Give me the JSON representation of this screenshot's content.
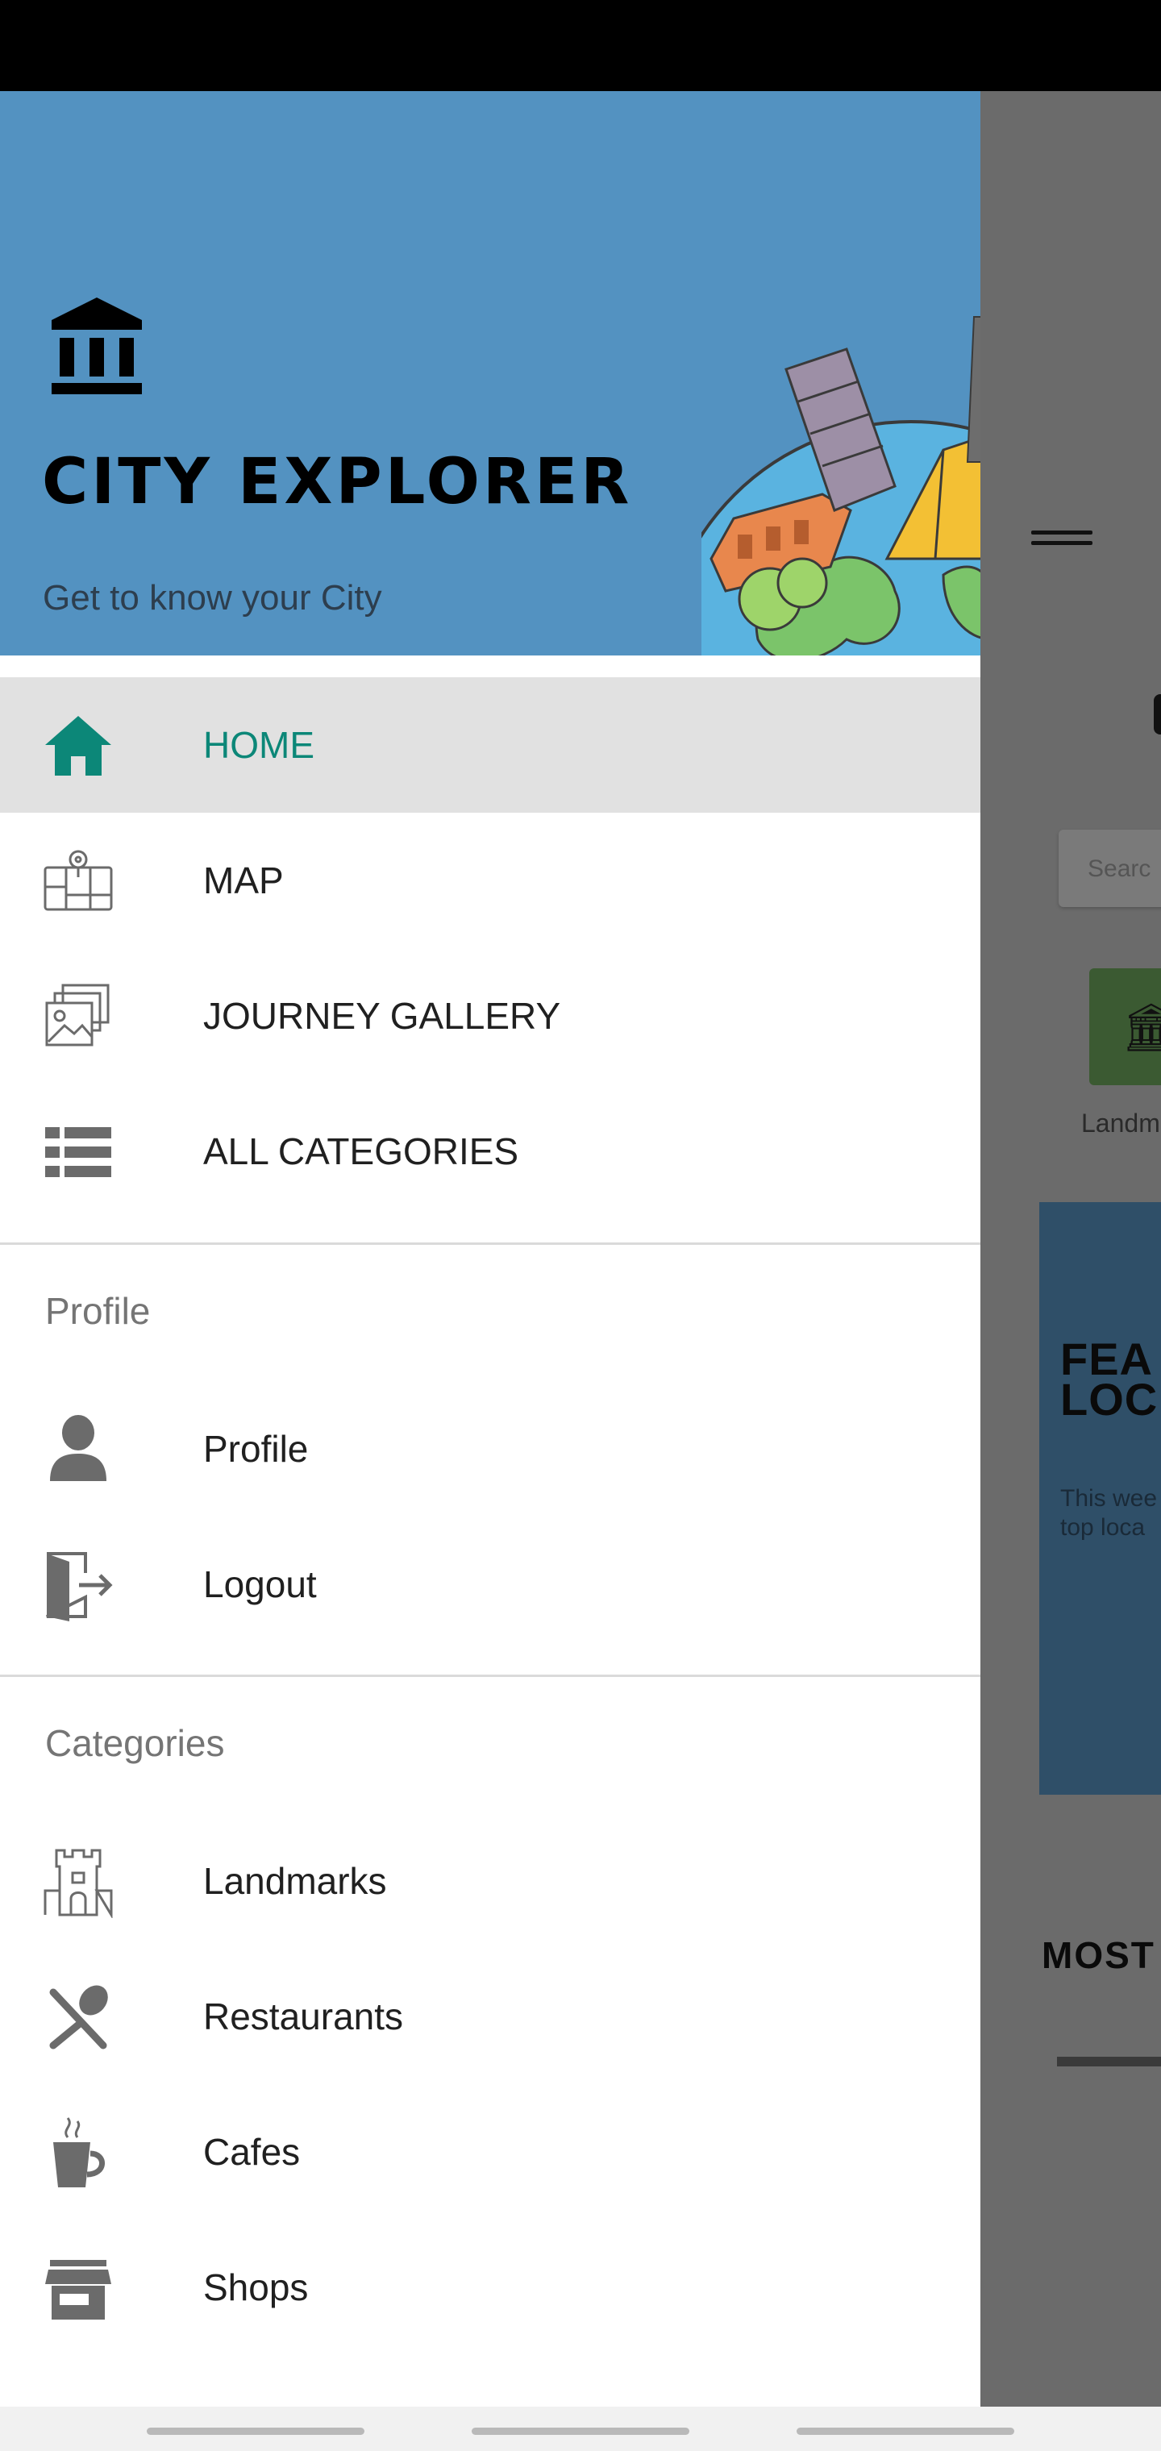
{
  "header": {
    "title": "CITY EXPLORER",
    "subtitle": "Get to know your City",
    "logo_icon": "museum-icon",
    "background_color": "#5392c1"
  },
  "nav": {
    "items": [
      {
        "label": "HOME",
        "icon": "home-icon",
        "active": true
      },
      {
        "label": "MAP",
        "icon": "map-icon",
        "active": false
      },
      {
        "label": "JOURNEY GALLERY",
        "icon": "gallery-icon",
        "active": false
      },
      {
        "label": "ALL CATEGORIES",
        "icon": "list-icon",
        "active": false
      }
    ]
  },
  "profile_section": {
    "heading": "Profile",
    "items": [
      {
        "label": "Profile",
        "icon": "person-icon"
      },
      {
        "label": "Logout",
        "icon": "logout-icon"
      }
    ]
  },
  "categories_section": {
    "heading": "Categories",
    "items": [
      {
        "label": "Landmarks",
        "icon": "castle-icon"
      },
      {
        "label": "Restaurants",
        "icon": "restaurant-icon"
      },
      {
        "label": "Cafes",
        "icon": "coffee-icon"
      },
      {
        "label": "Shops",
        "icon": "store-icon"
      }
    ]
  },
  "background_app": {
    "search_placeholder": "Searc",
    "category_label": "Landm",
    "feature_title": "FEA\nLOC",
    "feature_text": "This wee\ntop loca",
    "most_label": "MOST"
  },
  "colors": {
    "accent": "#0c8778",
    "active_item_bg": "#e1e1e1",
    "scrim": "#5f5f5f"
  }
}
